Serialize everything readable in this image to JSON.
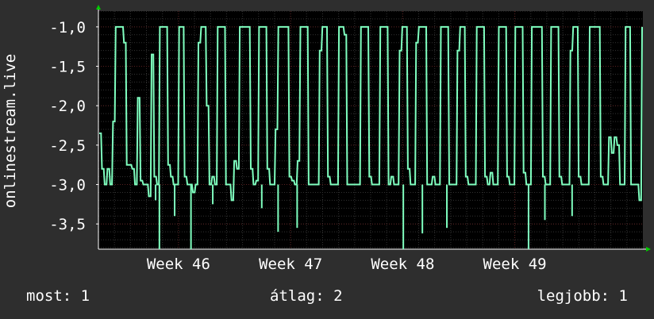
{
  "colors": {
    "background": "#2e2e2e",
    "plot_background": "#000000",
    "grid_minor": "#333333",
    "grid_major": "#5a2020",
    "axis": "#ffffff",
    "arrow": "#00cc00",
    "series": "#7fffbf"
  },
  "chart_data": {
    "type": "line",
    "ylabel": "onlinestream.live",
    "ylim": [
      -3.82,
      -0.8
    ],
    "yticks": [
      -1.0,
      -1.5,
      -2.0,
      -2.5,
      -3.0,
      -3.5
    ],
    "ytick_labels": [
      "-1,0",
      "-1,5",
      "-2,0",
      "-2,5",
      "-3,0",
      "-3,5"
    ],
    "xlim": [
      "2023-11-08",
      "2023-12-12"
    ],
    "xticks": [
      "2023-11-13",
      "2023-11-20",
      "2023-11-27",
      "2023-12-04"
    ],
    "xtick_labels": [
      "Week 46",
      "Week 47",
      "Week 48",
      "Week 49"
    ],
    "grid": true,
    "series": [
      {
        "values": [
          -2.35,
          -2.8,
          -3.0,
          -2.8,
          -3.0,
          -2.2,
          -1.0,
          -1.0,
          -1.0,
          -1.2,
          -2.75,
          -2.75,
          -2.8,
          -3.0,
          -1.9,
          -2.95,
          -3.0,
          -3.0,
          -3.15,
          -1.35,
          -2.9,
          -3.0,
          -1.0,
          -1.0,
          -1.0,
          -2.75,
          -2.9,
          -3.0,
          -3.0,
          -1.0,
          -1.0,
          -2.9,
          -3.0,
          -3.0,
          -3.1,
          -3.0,
          -1.2,
          -1.0,
          -1.0,
          -2.0,
          -3.0,
          -2.9,
          -3.0,
          -1.0,
          -1.0,
          -1.0,
          -3.0,
          -3.0,
          -3.2,
          -2.7,
          -2.8,
          -1.0,
          -1.0,
          -1.0,
          -1.0,
          -2.8,
          -3.0,
          -2.95,
          -1.0,
          -1.0,
          -1.0,
          -2.8,
          -3.0,
          -3.0,
          -2.3,
          -1.0,
          -1.0,
          -1.0,
          -1.0,
          -2.9,
          -2.95,
          -3.0,
          -2.7,
          -1.0,
          -1.0,
          -1.0,
          -3.0,
          -3.0,
          -3.0,
          -3.0,
          -1.3,
          -1.0,
          -1.0,
          -2.9,
          -3.0,
          -3.0,
          -3.0,
          -1.0,
          -1.0,
          -1.1,
          -3.0,
          -3.0,
          -3.0,
          -3.0,
          -3.0,
          -1.0,
          -1.0,
          -1.0,
          -2.9,
          -3.0,
          -3.0,
          -3.0,
          -1.0,
          -1.0,
          -1.0,
          -3.0,
          -2.9,
          -3.0,
          -3.0,
          -1.3,
          -1.0,
          -1.0,
          -2.8,
          -3.0,
          -3.0,
          -1.2,
          -1.0,
          -1.0,
          -1.0,
          -3.0,
          -3.0,
          -2.9,
          -3.0,
          -3.0,
          -1.0,
          -1.0,
          -1.0,
          -3.0,
          -3.0,
          -3.0,
          -1.3,
          -1.0,
          -1.0,
          -2.9,
          -3.0,
          -3.0,
          -3.0,
          -1.0,
          -1.0,
          -1.0,
          -2.9,
          -3.0,
          -2.85,
          -3.0,
          -3.0,
          -1.0,
          -1.0,
          -1.0,
          -2.9,
          -3.0,
          -3.0,
          -1.0,
          -1.0,
          -1.0,
          -2.85,
          -3.0,
          -3.0,
          -1.0,
          -1.0,
          -1.0,
          -1.0,
          -2.9,
          -3.0,
          -3.0,
          -1.0,
          -1.0,
          -1.0,
          -2.9,
          -3.0,
          -3.0,
          -3.0,
          -1.3,
          -1.0,
          -1.0,
          -2.9,
          -3.0,
          -3.0,
          -3.0,
          -1.0,
          -1.0,
          -1.0,
          -1.0,
          -2.9,
          -3.0,
          -3.0,
          -2.4,
          -2.6,
          -2.4,
          -2.5,
          -3.0,
          -3.0,
          -1.0,
          -1.0,
          -3.0,
          -3.0,
          -3.0,
          -3.2,
          -1.0
        ],
        "spikes": [
          [
            0.105,
            -3.2
          ],
          [
            0.112,
            -3.82
          ],
          [
            0.14,
            -3.4
          ],
          [
            0.17,
            -3.82
          ],
          [
            0.21,
            -3.25
          ],
          [
            0.3,
            -3.3
          ],
          [
            0.33,
            -3.6
          ],
          [
            0.365,
            -3.55
          ],
          [
            0.56,
            -3.82
          ],
          [
            0.595,
            -3.62
          ],
          [
            0.64,
            -3.55
          ],
          [
            0.79,
            -3.82
          ],
          [
            0.82,
            -3.45
          ],
          [
            0.87,
            -3.4
          ]
        ]
      }
    ]
  },
  "footer": {
    "now": "most: 1",
    "avg": "átlag: 2",
    "max": "legjobb: 1"
  }
}
